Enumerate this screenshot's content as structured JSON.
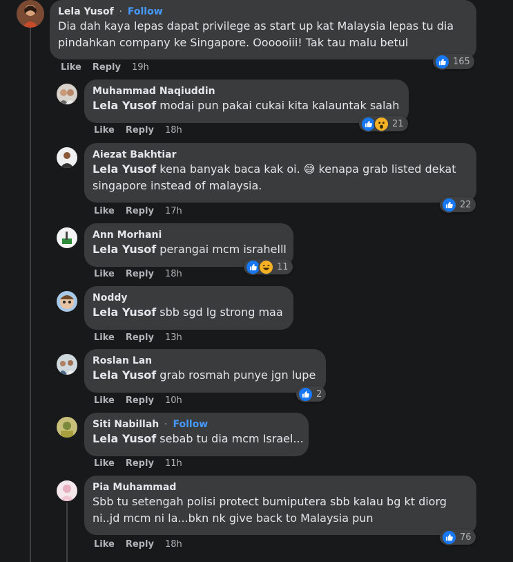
{
  "colors": {
    "background": "#18191a",
    "bubble": "#3a3b3c",
    "text": "#e4e6eb",
    "secondary_text": "#b0b3b8",
    "link": "#4599ff",
    "like_blue": "#1877f2"
  },
  "actions": {
    "like": "Like",
    "reply": "Reply"
  },
  "main_comment": {
    "author": "Lela Yusof",
    "follow_label": "Follow",
    "separator": "·",
    "line1": "Dia dah kaya lepas dapat privilege as start up kat Malaysia lepas tu dia",
    "line2": "pindahkan company ke Singapore. Oooooiii! Tak tau malu betul",
    "time": "19h",
    "reaction_count": "165",
    "reaction_icons": [
      "like-icon"
    ]
  },
  "replies": [
    {
      "author": "Muhammad Naqiuddin",
      "mention": "Lela Yusof",
      "line1": "modai pun pakai cukai kita kalauntak salah",
      "time": "18h",
      "reaction_count": "21",
      "reaction_icons": [
        "like-icon",
        "wow-icon"
      ]
    },
    {
      "author": "Aiezat Bakhtiar",
      "mention": "Lela Yusof",
      "line1": "kena banyak baca kak oi. 😅 kenapa grab listed dekat",
      "line2": "singapore instead of malaysia.",
      "time": "17h",
      "reaction_count": "22",
      "reaction_icons": [
        "like-icon"
      ]
    },
    {
      "author": "Ann Morhani",
      "mention": "Lela Yusof",
      "line1": "perangai mcm israhelll",
      "time": "18h",
      "reaction_count": "11",
      "reaction_icons": [
        "like-icon",
        "haha-icon"
      ]
    },
    {
      "author": "Noddy",
      "mention": "Lela Yusof",
      "line1": "sbb sgd lg strong maa",
      "time": "13h"
    },
    {
      "author": "Roslan Lan",
      "mention": "Lela Yusof",
      "line1": "grab rosmah punye jgn lupe",
      "time": "10h",
      "reaction_count": "2",
      "reaction_icons": [
        "like-icon"
      ]
    },
    {
      "author": "Siti Nabillah",
      "follow_label": "Follow",
      "mention": "Lela Yusof",
      "line1": "sebab tu dia mcm Israel...",
      "time": "11h"
    },
    {
      "author": "Pia Muhammad",
      "line1": "Sbb tu setengah polisi protect bumiputera sbb kalau bg kt diorg",
      "line2": "ni..jd mcm ni la...bkn nk give back to Malaysia pun",
      "time": "18h",
      "reaction_count": "76",
      "reaction_icons": [
        "like-icon"
      ]
    }
  ]
}
